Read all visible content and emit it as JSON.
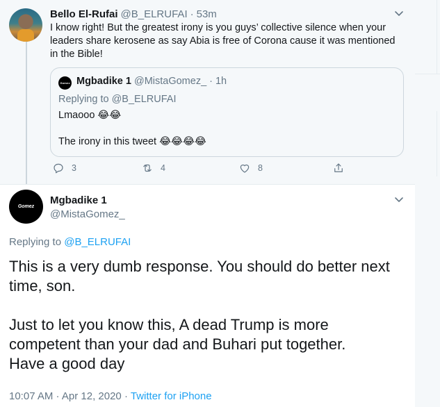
{
  "parent": {
    "name": "Bello El-Rufai",
    "handle": "@B_ELRUFAI",
    "separator": "·",
    "time": "53m",
    "lines": [
      "I know right! But the greatest irony is you guys’ collective silence when your",
      "leaders share kerosene as say Abia is free of Corona cause it was mentioned",
      "in the Bible!"
    ],
    "quote": {
      "name": "Mgbadike 1",
      "handle": "@MistaGomez_",
      "separator": "·",
      "time": "1h",
      "avatar_text": "Gomez",
      "replying_prefix": "Replying to",
      "replying_to": "@B_ELRUFAI",
      "line1": "Lmaooo 😂😂",
      "line2": "The irony in this tweet 😂😂😂😂"
    },
    "actions": {
      "reply": {
        "icon": "reply-icon",
        "count": "3"
      },
      "retweet": {
        "icon": "retweet-icon",
        "count": "4"
      },
      "like": {
        "icon": "heart-icon",
        "count": "8"
      },
      "share": {
        "icon": "share-icon"
      }
    }
  },
  "main": {
    "name": "Mgbadike 1",
    "handle": "@MistaGomez_",
    "avatar_text": "Gomez",
    "replying_prefix": "Replying to",
    "replying_to": "@B_ELRUFAI",
    "text_lines_1": [
      "This is a very dumb response. You should do better next",
      "time, son."
    ],
    "text_lines_2": [
      "Just to let you know this, A dead Trump is more",
      "competent than your dad and Buhari put together.",
      "Have a good day"
    ],
    "timestamp": "10:07 AM · Apr 12, 2020",
    "meta_separator": "·",
    "source": "Twitter for iPhone"
  },
  "colors": {
    "text": "#14171a",
    "secondary": "#657786",
    "accent": "#1da1f2",
    "context_bg": "#f5f8fa",
    "border": "#ccd6dd"
  }
}
